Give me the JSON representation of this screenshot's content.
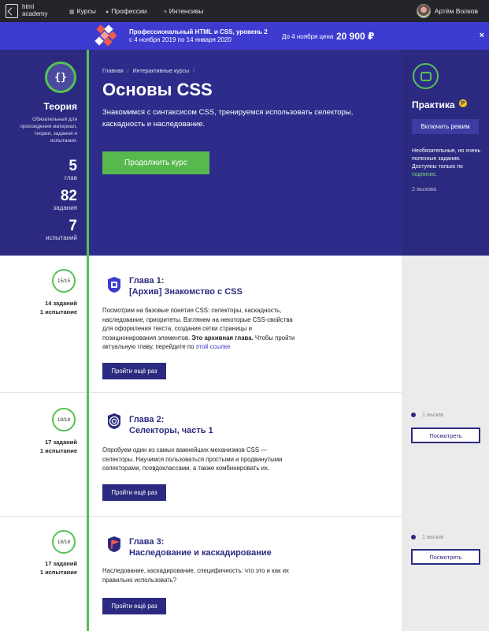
{
  "topnav": {
    "logo_line1": "html",
    "logo_line2": "academy",
    "items": [
      {
        "label": "Курсы",
        "icon": "grid-icon"
      },
      {
        "label": "Профессии",
        "icon": "bulb-icon"
      },
      {
        "label": "Интенсивы",
        "icon": "bolt-icon"
      }
    ],
    "user_name": "Артём Волков"
  },
  "promo": {
    "title": "Профессиональный HTML и CSS, уровень 2",
    "dates": "с 4 ноября 2019 по 14 января 2020",
    "price_prefix": "До 4 ноября цена",
    "price": "20 900 ₽",
    "close": "×"
  },
  "theory": {
    "icon": "{}",
    "title": "Теория",
    "desc": "Обязательный для прохождения материал, теория, задания и испытания.",
    "stats": [
      {
        "num": "5",
        "label": "глав"
      },
      {
        "num": "82",
        "label": "задания"
      },
      {
        "num": "7",
        "label": "испытаний"
      }
    ]
  },
  "hero": {
    "breadcrumbs": [
      "Главная",
      "Интерактивные курсы"
    ],
    "title": "Основы CSS",
    "desc": "Знакомимся с синтаксисом CSS, тренируемся использовать селекторы, каскадность и наследование.",
    "continue_label": "Продолжить курс"
  },
  "practice": {
    "title": "Практика",
    "badge": "P",
    "enable_label": "Включить режим",
    "note_line1": "Необязательные, но очень полезные задания. Доступны только по ",
    "note_link": "подписке",
    "note_end": ".",
    "calls": "2 вызова"
  },
  "chapters": [
    {
      "progress": "15/15",
      "tasks": "14 заданий",
      "trials": "1 испытание",
      "title_line1": "Глава 1:",
      "title_line2": "[Архив] Знакомство с CSS",
      "desc_main": "Посмотрим на базовые понятия CSS: селекторы, каскадность, наследование, приоритеты. Взглянем на некоторые CSS-свойства для оформления текста, создания сетки страницы и позиционирования элементов. ",
      "desc_bold": "Это архивная глава.",
      "desc_tail": " Чтобы пройти актуальную главу, перейдите по ",
      "desc_link": "этой ссылке",
      "button": "Пройти ещё раз"
    },
    {
      "progress": "18/18",
      "tasks": "17 заданий",
      "trials": "1 испытание",
      "title_line1": "Глава 2:",
      "title_line2": "Селекторы, часть 1",
      "desc_main": "Опробуем один из самых важнейших механизмов CSS — селекторы. Научимся пользоваться простыми и продвинутыми селекторами, псевдоклассами, а также комбинировать их.",
      "button": "Пройти ещё раз",
      "calls": "1 вызов",
      "view": "Посмотреть"
    },
    {
      "progress": "18/18",
      "tasks": "17 заданий",
      "trials": "1 испытание",
      "title_line1": "Глава 3:",
      "title_line2": "Наследование и каскадирование",
      "desc_main": "Наследование, каскадирование, специфичность: что это и как их правильно использовать?",
      "button": "Пройти ещё раз",
      "calls": "1 вызов",
      "view": "Посмотреть"
    }
  ],
  "colors": {
    "accent_green": "#57c153",
    "brand_indigo": "#2b2a80",
    "promo_blue": "#3d3bd0"
  }
}
